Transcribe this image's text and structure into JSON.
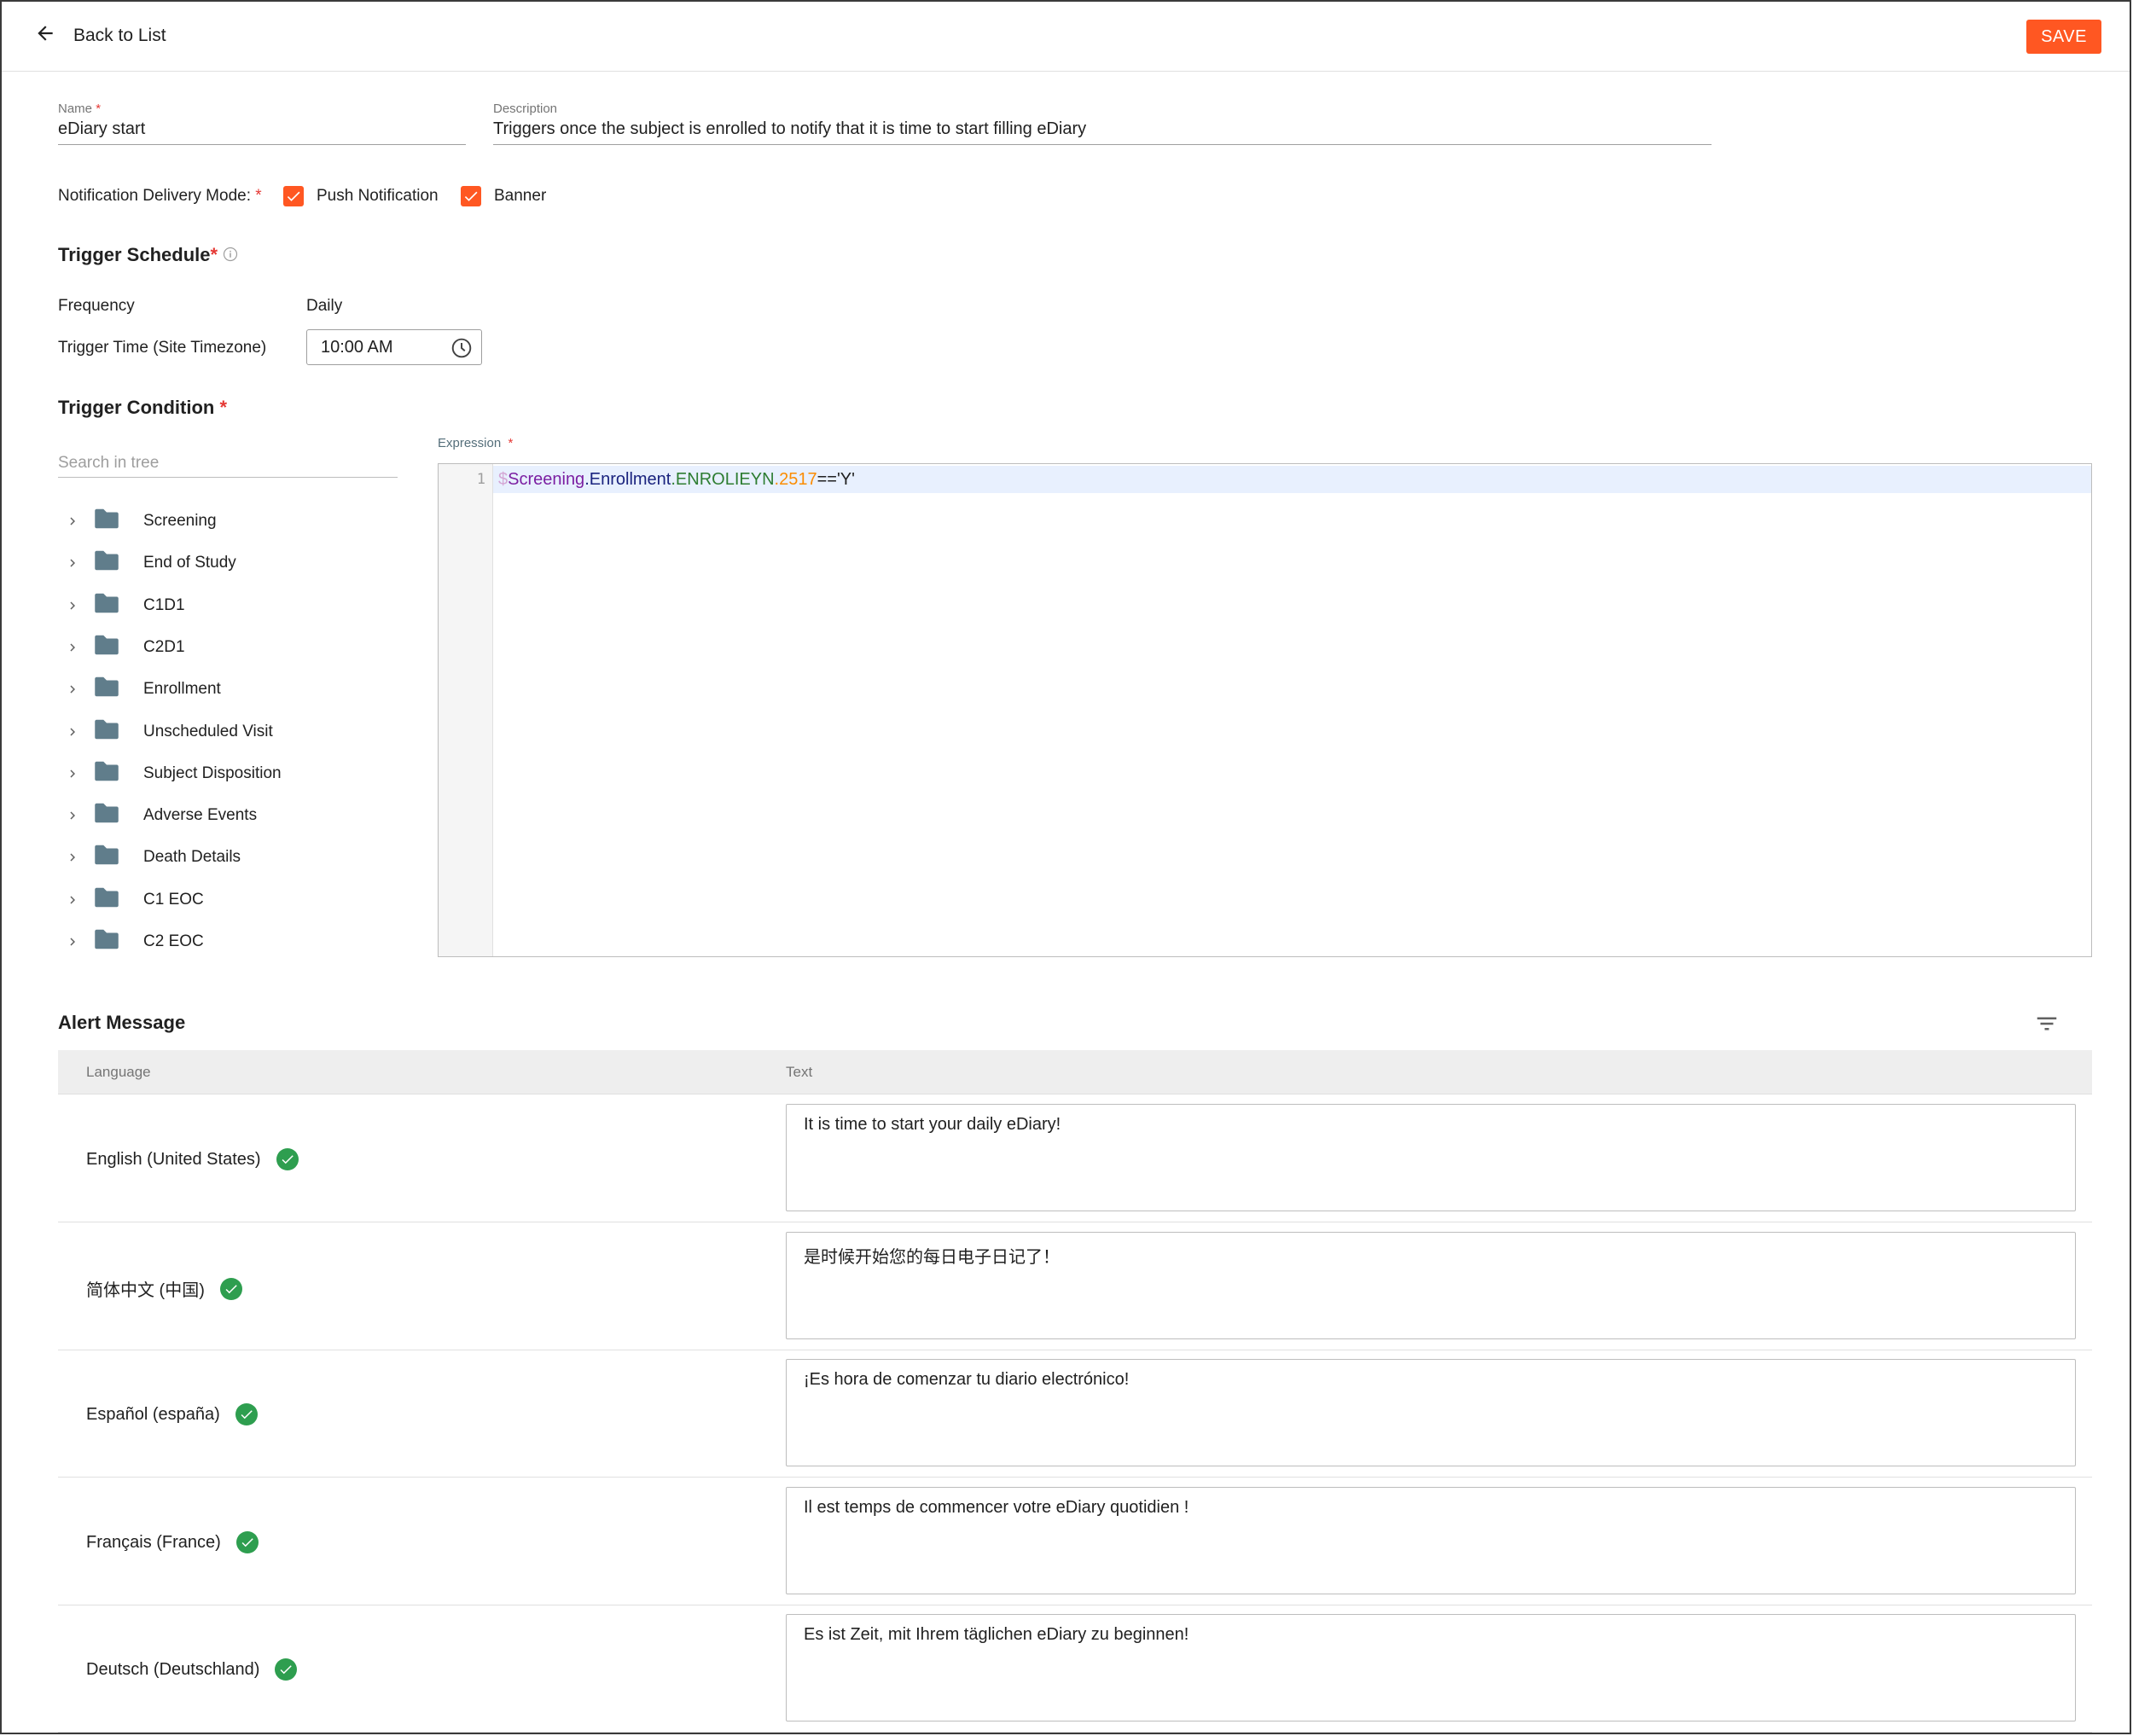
{
  "header": {
    "back_label": "Back to List",
    "save_label": "SAVE"
  },
  "form": {
    "name": {
      "label": "Name",
      "required_mark": "*",
      "value": "eDiary start"
    },
    "description": {
      "label": "Description",
      "value": "Triggers once the subject is enrolled to notify that it is time to start filling eDiary"
    },
    "delivery": {
      "label": "Notification Delivery Mode:",
      "required_mark": "*",
      "options": [
        {
          "label": "Push Notification",
          "checked": true
        },
        {
          "label": "Banner",
          "checked": true
        }
      ]
    }
  },
  "schedule": {
    "title": "Trigger Schedule",
    "required_mark": "*",
    "frequency_label": "Frequency",
    "frequency_value": "Daily",
    "time_label": "Trigger Time (Site Timezone)",
    "time_value": "10:00 AM"
  },
  "condition": {
    "title": "Trigger Condition",
    "required_mark": "*",
    "search_placeholder": "Search in tree",
    "tree": [
      "Screening",
      "End of Study",
      "C1D1",
      "C2D1",
      "Enrollment",
      "Unscheduled Visit",
      "Subject Disposition",
      "Adverse Events",
      "Death Details",
      "C1 EOC",
      "C2 EOC"
    ],
    "expression_label": "Expression",
    "expression_required_mark": "*",
    "line_number": "1",
    "expression_tokens": {
      "dollar": "$",
      "t1": "Screening",
      "dot1": ".",
      "t2": "Enrollment",
      "dot2": ".",
      "t3": "ENROLIEYN",
      "dot3": ".",
      "t4": "2517",
      "t5": "=='Y'"
    }
  },
  "alert": {
    "title": "Alert Message",
    "col_language": "Language",
    "col_text": "Text",
    "rows": [
      {
        "language": "English (United States)",
        "text": "It is time to start your daily eDiary!"
      },
      {
        "language": "简体中文 (中国)",
        "text": "是时候开始您的每日电子日记了！"
      },
      {
        "language": "Español (españa)",
        "text": "¡Es hora de comenzar tu diario electrónico!"
      },
      {
        "language": "Français (France)",
        "text": "Il est temps de commencer votre eDiary quotidien !"
      },
      {
        "language": "Deutsch (Deutschland)",
        "text": "Es ist Zeit, mit Ihrem täglichen eDiary zu beginnen!"
      }
    ]
  },
  "colors": {
    "accent": "#ff5722",
    "success": "#2e9e4f",
    "folder": "#607d8b"
  },
  "icons": {
    "back": "arrow-left-icon",
    "info": "info-icon",
    "clock": "clock-icon",
    "chevron": "chevron-right-icon",
    "folder": "folder-icon",
    "filter": "filter-icon",
    "status": "check-circle-icon"
  }
}
